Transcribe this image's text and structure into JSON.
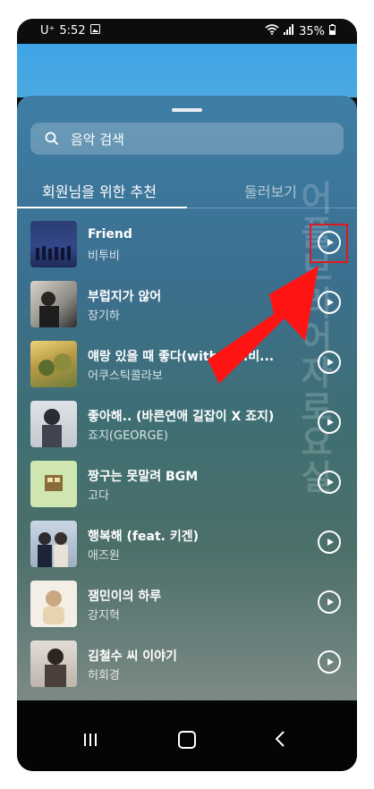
{
  "status": {
    "carrier": "U⁺",
    "time": "5:52",
    "battery": "35%"
  },
  "search": {
    "placeholder": "음악 검색"
  },
  "tabs": {
    "recommended": "회원님을 위한 추천",
    "browse": "둘러보기"
  },
  "watermark": "어플브리어자로요실",
  "songs": [
    {
      "title": "Friend",
      "artist": "비투비"
    },
    {
      "title": "부럽지가 않어",
      "artist": "장기하"
    },
    {
      "title": "얘랑 있을 때 좋다(with 김...비...",
      "artist": "어쿠스틱콜라보"
    },
    {
      "title": "좋아해.. (바른연애 길잡이 X 죠지)",
      "artist": "죠지(GEORGE)"
    },
    {
      "title": "짱구는 못말려 BGM",
      "artist": "고다"
    },
    {
      "title": "행복해 (feat. 키겐)",
      "artist": "애즈원"
    },
    {
      "title": "잼민이의 하루",
      "artist": "강지혁"
    },
    {
      "title": "김철수 씨 이야기",
      "artist": "허회경"
    }
  ],
  "colors": {
    "accent": "#e0191e",
    "sheet_top": "#3e7ea6"
  },
  "icons": [
    "search-icon",
    "play-icon",
    "nav-recent-icon",
    "nav-home-icon",
    "nav-back-icon"
  ]
}
